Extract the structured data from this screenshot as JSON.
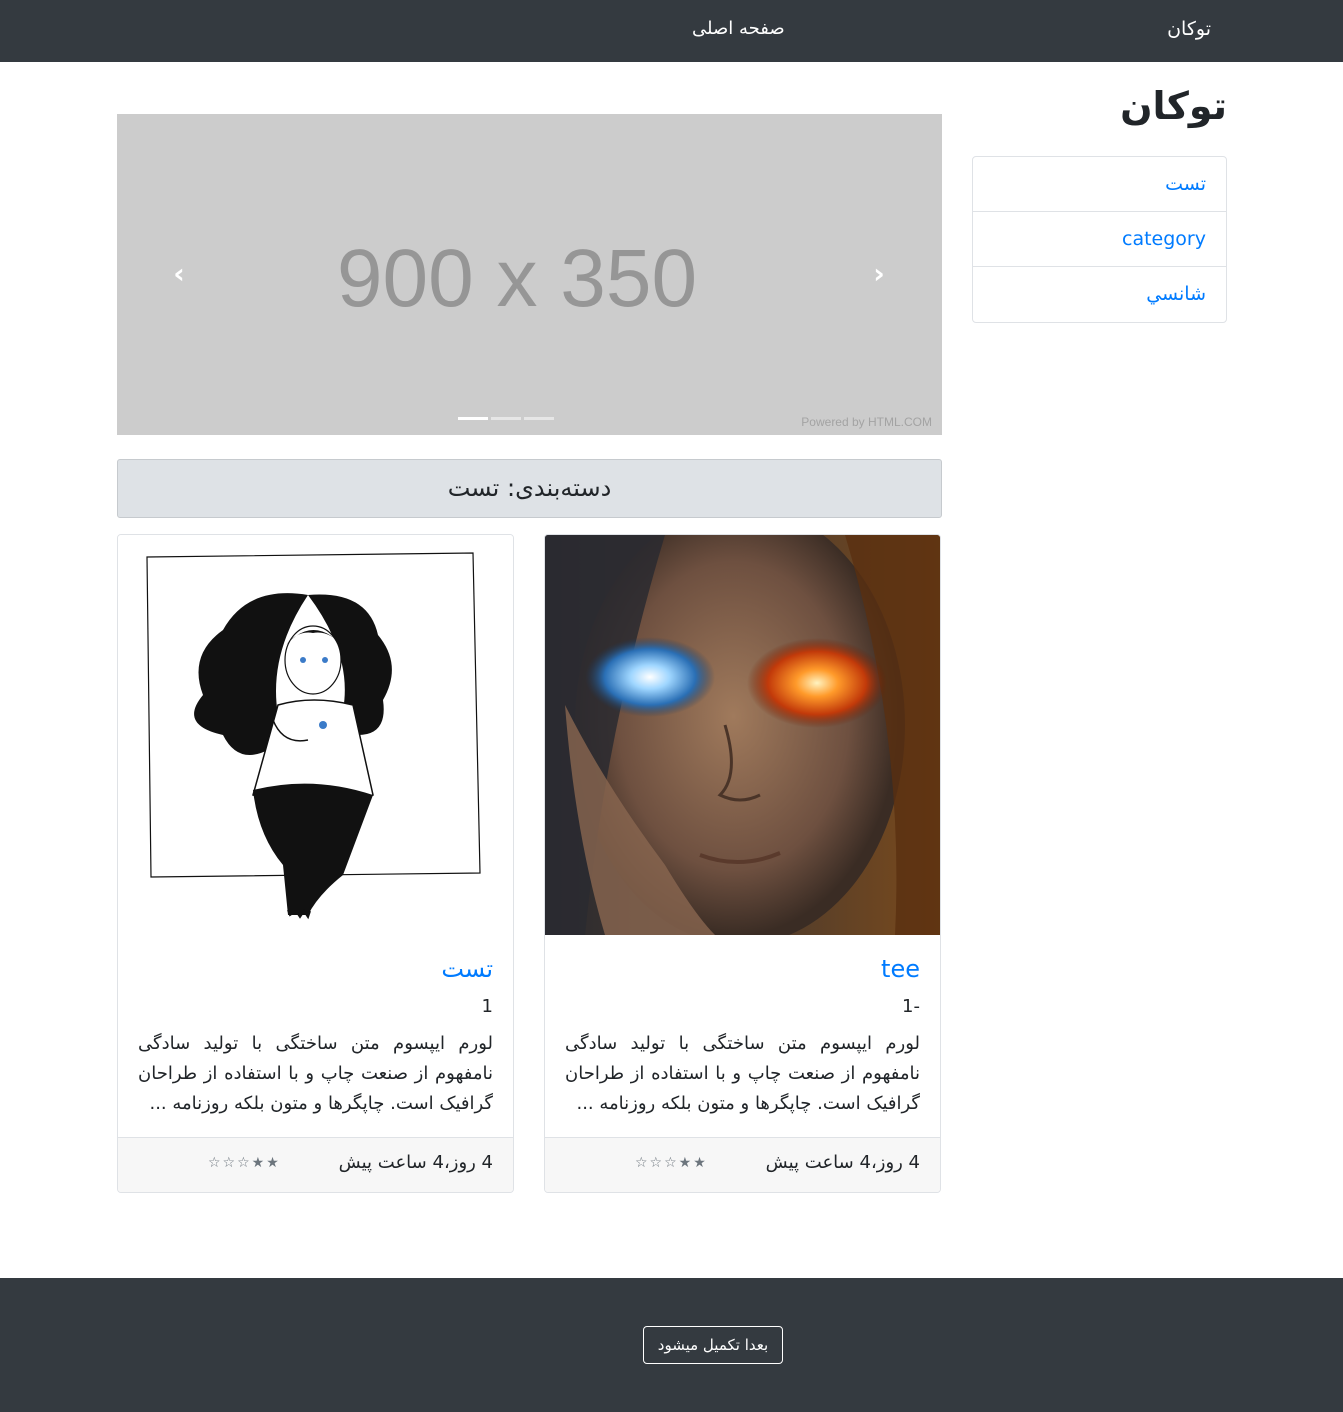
{
  "navbar": {
    "brand": "توکان",
    "home_link": "صفحه اصلی"
  },
  "sidebar": {
    "title": "توکان",
    "categories": [
      {
        "label": "تست"
      },
      {
        "label": "category"
      },
      {
        "label": "شانسي"
      }
    ]
  },
  "carousel": {
    "placeholder_text": "900 x 350",
    "powered_by": "Powered by HTML.COM",
    "prev_symbol": "‹",
    "next_symbol": "›",
    "slide_count": 3,
    "active_slide": 1
  },
  "category_header": "دسته‌بندی: تست",
  "posts": [
    {
      "title": "tee",
      "subtitle": "-1",
      "excerpt": "لورم ایپسوم متن ساختگی با تولید سادگی نامفهوم از صنعت چاپ و با استفاده از طراحان گرافیک است. چاپگرها و متون بلکه روزنامه ...",
      "time": "4 روز،4 ساعت پیش",
      "rating": 2,
      "rating_max": 5,
      "stars_text": "★★☆☆☆",
      "image": "fire-ice-eyes-woman-image"
    },
    {
      "title": "تست",
      "subtitle": "1",
      "excerpt": "لورم ایپسوم متن ساختگی با تولید سادگی نامفهوم از صنعت چاپ و با استفاده از طراحان گرافیک است. چاپگرها و متون بلکه روزنامه ...",
      "time": "4 روز،4 ساعت پیش",
      "rating": 2,
      "rating_max": 5,
      "stars_text": "★★☆☆☆",
      "image": "sketch-girl-image"
    }
  ],
  "footer": {
    "button_label": "بعدا تکمیل میشود"
  }
}
